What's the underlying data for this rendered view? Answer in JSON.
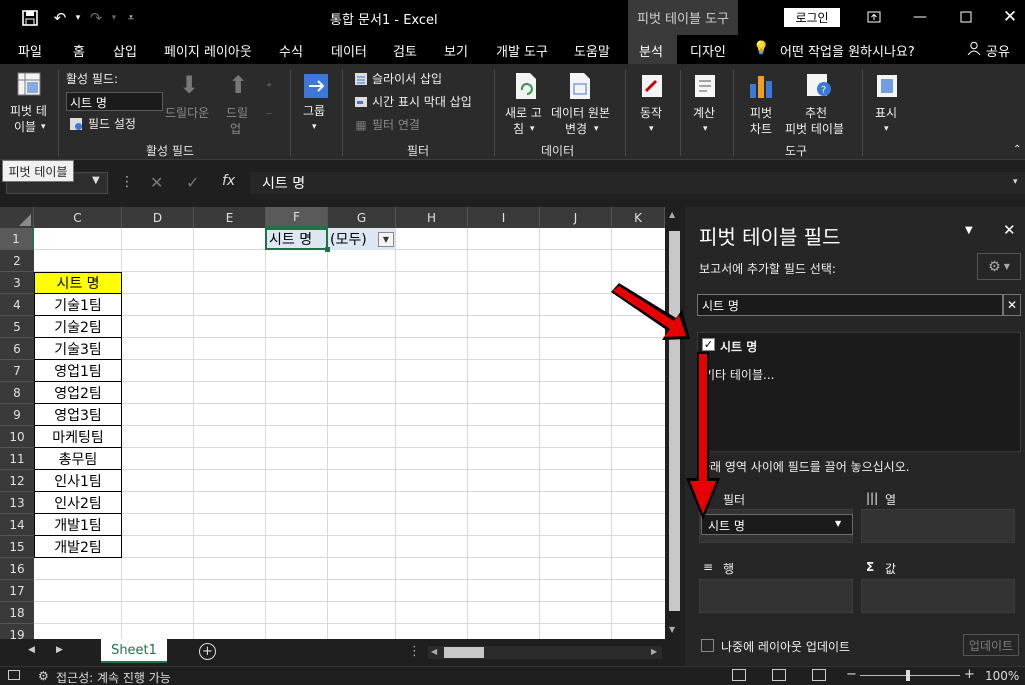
{
  "titlebar": {
    "doc_title": "통합 문서1  -  Excel",
    "context_tool": "피벗 테이블 도구",
    "login": "로그인"
  },
  "tabs": [
    "파일",
    "홈",
    "삽입",
    "페이지 레이아웃",
    "수식",
    "데이터",
    "검토",
    "보기",
    "개발 도구",
    "도움말",
    "분석",
    "디자인"
  ],
  "tell_me": "어떤 작업을 원하시나요?",
  "share": "공유",
  "ribbon": {
    "pivot_table_label_1": "피벗 테",
    "pivot_table_label_2": "이블",
    "active_field_label": "활성 필드:",
    "active_field_value": "시트 명",
    "field_settings": "필드 설정",
    "drill_down": "드릴다운",
    "drill_up_1": "드릴",
    "drill_up_2": "업",
    "group_active_field": "활성 필드",
    "group_label": "그룹",
    "insert_slicer": "슬라이서 삽입",
    "insert_timeline": "시간 표시 막대 삽입",
    "filter_connections": "필터 연결",
    "group_filter": "필터",
    "refresh_1": "새로 고",
    "refresh_2": "침",
    "change_source_1": "데이터 원본",
    "change_source_2": "변경",
    "group_data": "데이터",
    "actions": "동작",
    "calculations": "계산",
    "pivot_chart_1": "피벗",
    "pivot_chart_2": "차트",
    "recommended_1": "추천",
    "recommended_2": "피벗 테이블",
    "group_tools": "도구",
    "show": "표시"
  },
  "tooltip": "피벗 테이블",
  "formula": {
    "fx": "fx",
    "value": "시트 명"
  },
  "columns": [
    "C",
    "D",
    "E",
    "F",
    "G",
    "H",
    "I",
    "J",
    "K"
  ],
  "rows": [
    "1",
    "2",
    "3",
    "4",
    "5",
    "6",
    "7",
    "8",
    "9",
    "10",
    "11",
    "12",
    "13",
    "14",
    "15",
    "16",
    "17",
    "18",
    "19"
  ],
  "cells": {
    "f1": "시트 명",
    "g1": "(모두)",
    "c_list": [
      "시트 명",
      "기술1팀",
      "기술2팀",
      "기술3팀",
      "영업1팀",
      "영업2팀",
      "영업3팀",
      "마케팅팀",
      "총무팀",
      "인사1팀",
      "인사2팀",
      "개발1팀",
      "개발2팀"
    ]
  },
  "sheet_tab": "Sheet1",
  "status": {
    "accessibility": "접근성: 계속 진행 가능",
    "zoom": "100%"
  },
  "pane": {
    "title": "피벗 테이블 필드",
    "subtitle": "보고서에 추가할 필드 선택:",
    "search_value": "시트 명",
    "field_name": "시트 명",
    "more_tables": "기타 테이블...",
    "drag_hint": "아래 영역 사이에 필드를 끌어 놓으십시오.",
    "filters_label": "필터",
    "columns_label": "열",
    "rows_label": "행",
    "values_label": "값",
    "filter_item": "시트 명",
    "defer_label": "나중에 레이아웃 업데이트",
    "update_button": "업데이트"
  },
  "colors": {
    "accent_red": "#e60000",
    "highlight_yellow": "#ffff00",
    "excel_green": "#217346"
  }
}
